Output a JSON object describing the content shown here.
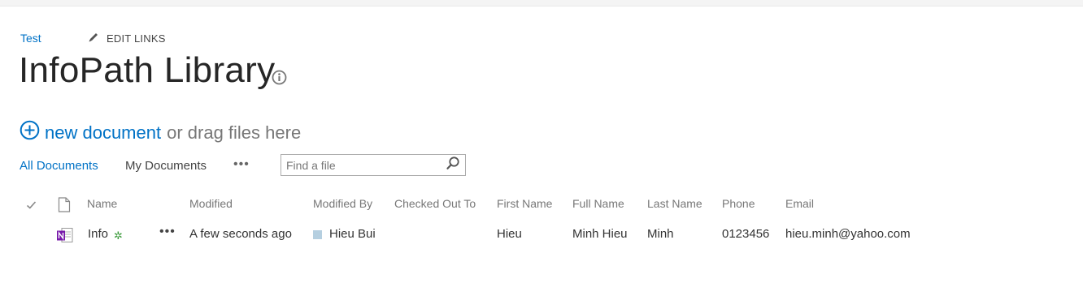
{
  "breadcrumb": {
    "site_link": "Test",
    "edit_links": "EDIT LINKS"
  },
  "page": {
    "title": "InfoPath Library"
  },
  "new_document": {
    "link": "new document",
    "suffix": "or drag files here"
  },
  "views": {
    "all": "All Documents",
    "mine": "My Documents",
    "more": "•••"
  },
  "search": {
    "placeholder": "Find a file",
    "value": ""
  },
  "table": {
    "columns": [
      "Name",
      "Modified",
      "Modified By",
      "Checked Out To",
      "First Name",
      "Full Name",
      "Last Name",
      "Phone",
      "Email"
    ],
    "rows": [
      {
        "name": "Info",
        "new_marker": "✲",
        "actions": "•••",
        "modified": "A few seconds ago",
        "modified_by": "Hieu Bui",
        "checked_out_to": "",
        "first_name": "Hieu",
        "full_name": "Minh Hieu",
        "last_name": "Minh",
        "phone": "0123456",
        "email": "hieu.minh@yahoo.com"
      }
    ]
  },
  "icons": {
    "edit": "pencil-icon",
    "info": "info-circle-icon",
    "add": "plus-circle-icon",
    "search": "magnifier-icon",
    "select_all": "checkmark-icon",
    "type_header": "document-icon",
    "file_type": "onenote-file-icon"
  },
  "colors": {
    "link": "#0072c6",
    "onenote": "#7719aa",
    "new_marker": "#3a9a3a"
  }
}
